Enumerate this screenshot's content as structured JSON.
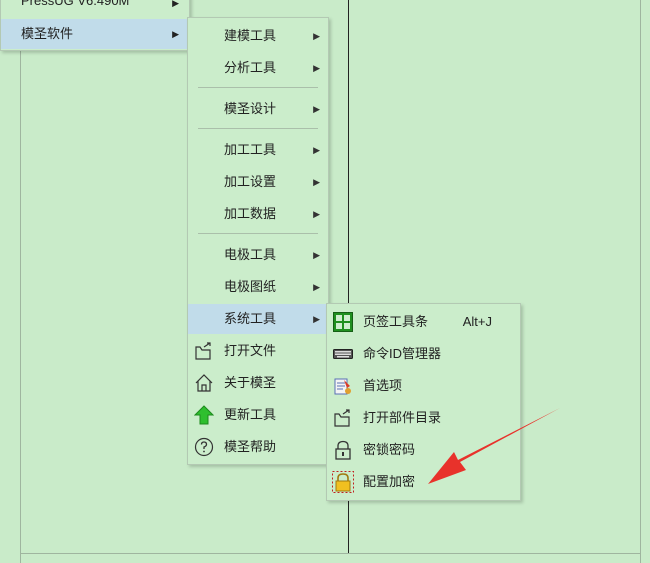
{
  "main_menu": {
    "items": [
      {
        "label": "PressUG  V6.490M"
      },
      {
        "label": "模圣软件"
      }
    ]
  },
  "sub_menu": {
    "items": [
      {
        "label": "建模工具"
      },
      {
        "label": "分析工具"
      },
      {
        "label": "模圣设计"
      },
      {
        "label": "加工工具"
      },
      {
        "label": "加工设置"
      },
      {
        "label": "加工数据"
      },
      {
        "label": "电极工具"
      },
      {
        "label": "电极图纸"
      },
      {
        "label": "系统工具"
      },
      {
        "label": "打开文件"
      },
      {
        "label": "关于模圣"
      },
      {
        "label": "更新工具"
      },
      {
        "label": "模圣帮助"
      }
    ]
  },
  "system_menu": {
    "items": [
      {
        "label": "页签工具条",
        "shortcut": "Alt+J"
      },
      {
        "label": "命令ID管理器"
      },
      {
        "label": "首选项"
      },
      {
        "label": "打开部件目录"
      },
      {
        "label": "密锁密码"
      },
      {
        "label": "配置加密"
      }
    ]
  },
  "colors": {
    "background": "#c9ebc9",
    "highlight": "#c1dcea",
    "annotation_arrow": "#e8322b"
  }
}
